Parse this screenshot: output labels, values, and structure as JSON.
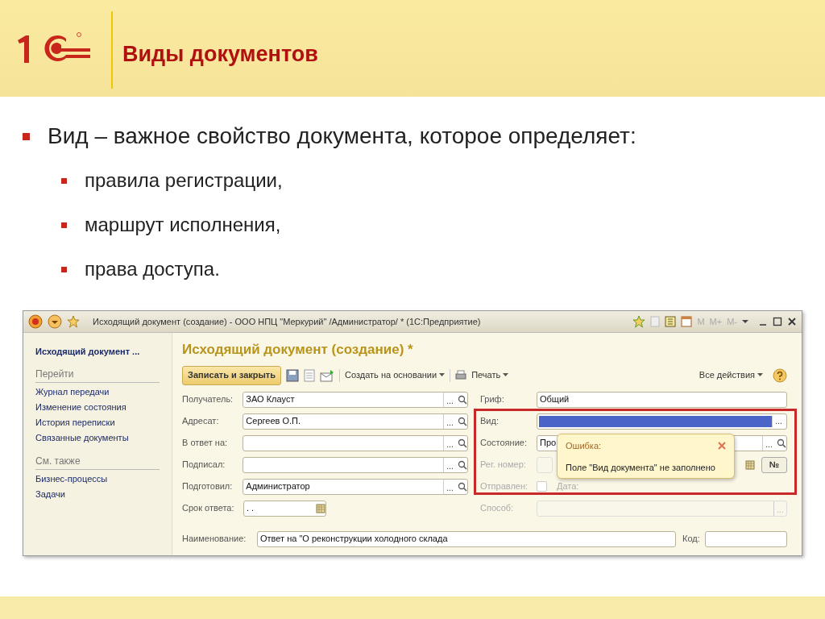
{
  "slide": {
    "title": "Виды документов",
    "bullet": "Вид – важное свойство документа, которое определяет:",
    "sub_bullets": [
      "правила регистрации,",
      "маршрут исполнения,",
      "права доступа."
    ]
  },
  "window": {
    "title": "Исходящий документ (создание) - ООО НПЦ \"Меркурий\" /Администратор/ * (1С:Предприятие)",
    "memory_buttons": [
      "M",
      "M+",
      "M-"
    ]
  },
  "sidebar": {
    "header": "Исходящий документ ...",
    "sections": [
      {
        "title": "Перейти",
        "items": [
          "Журнал передачи",
          "Изменение состояния",
          "История переписки",
          "Связанные документы"
        ]
      },
      {
        "title": "См. также",
        "items": [
          "Бизнес-процессы",
          "Задачи"
        ]
      }
    ]
  },
  "form": {
    "heading": "Исходящий документ (создание) *",
    "toolbar": {
      "primary": "Записать и закрыть",
      "create_based": "Создать на основании",
      "print": "Печать",
      "all_actions": "Все действия"
    },
    "left_fields": [
      {
        "kind": "lookup",
        "label": "Получатель:",
        "value": "ЗАО Клауст",
        "ellipsis": "..."
      },
      {
        "kind": "lookup",
        "label": "Адресат:",
        "value": "Сергеев О.П.",
        "ellipsis": "..."
      },
      {
        "kind": "lookup",
        "label": "В ответ на:",
        "ellipsis": "..."
      },
      {
        "kind": "lookup",
        "label": "Подписал:",
        "ellipsis": "..."
      },
      {
        "kind": "lookup",
        "label": "Подготовил:",
        "value": "Администратор",
        "ellipsis": "..."
      },
      {
        "kind": "date",
        "label": "Срок ответа:",
        "value": ". ."
      }
    ],
    "right_fields": [
      {
        "kind": "choice",
        "label": "Гриф:",
        "value": "Общий",
        "disabled": false,
        "highlighted": false
      },
      {
        "kind": "choice",
        "label": "Вид:",
        "disabled": false,
        "highlighted": true,
        "ellipsis": "..."
      },
      {
        "kind": "lookup",
        "label": "Состояние:",
        "value": "Про",
        "disabled": false,
        "highlighted": false,
        "ellipsis": "..."
      },
      {
        "kind": "regnum",
        "label": "Рег. номер:",
        "disabled": true,
        "highlighted": false,
        "button": "№"
      },
      {
        "kind": "sent",
        "label": "Отправлен:",
        "checked": false,
        "disabled": true,
        "highlighted": false,
        "date_label": "Дата:"
      },
      {
        "kind": "choice",
        "label": "Способ:",
        "disabled": true,
        "highlighted": false,
        "ellipsis": "..."
      }
    ],
    "name_label": "Наименование:",
    "name_value": "Ответ на \"О реконструкции холодного склада",
    "code_label": "Код:"
  },
  "error_tooltip": {
    "title": "Ошибка:",
    "message": "Поле \"Вид документа\" не заполнено"
  }
}
